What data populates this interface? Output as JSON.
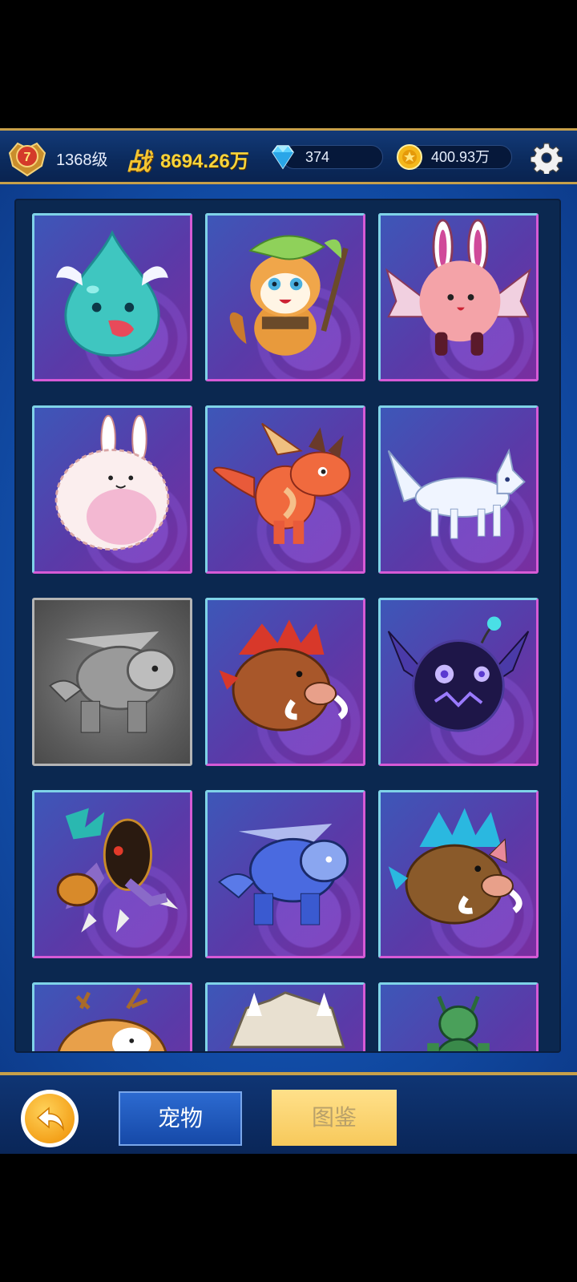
{
  "header": {
    "vip_level": "7",
    "player_level": "1368级",
    "power_label": "战",
    "power_value": "8694.26万",
    "diamonds": "374",
    "gold": "400.93万"
  },
  "pet_grid": {
    "rows": [
      [
        "water-drop-spirit",
        "leaf-squirrel",
        "winged-pink-puff"
      ],
      [
        "white-fluffy-rabbit",
        "red-dragon",
        "white-wolf"
      ],
      [
        "locked-gray-beast",
        "red-mane-boar",
        "dark-bat-orb"
      ],
      [
        "armored-mantis-beast",
        "blue-wolf-beast",
        "blue-mane-boar"
      ],
      [
        "antler-deer-creature",
        "rock-golem",
        "green-goblin"
      ]
    ],
    "locked": [
      "locked-gray-beast"
    ]
  },
  "bottom_nav": {
    "back_icon": "back-arrow-icon",
    "tab_pets": "宠物",
    "tab_codex": "图鉴"
  },
  "colors": {
    "gold_text": "#f8d43a",
    "header_bg": "#0b2a5c",
    "cell_border_light": "#7fd3e8",
    "cell_border_pink": "#d65ad6"
  }
}
